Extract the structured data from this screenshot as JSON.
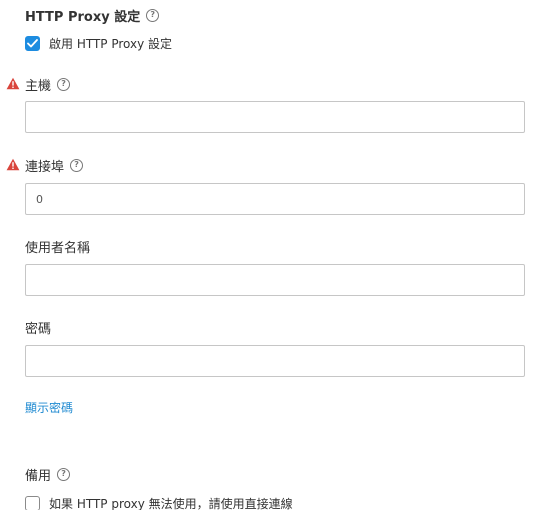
{
  "proxy_settings": {
    "title": "HTTP Proxy 設定",
    "enable_checkbox": {
      "label": "啟用 HTTP Proxy 設定",
      "checked": true
    }
  },
  "fields": {
    "host": {
      "label": "主機",
      "value": "",
      "required_warning": true
    },
    "port": {
      "label": "連接埠",
      "value": "0",
      "required_warning": true
    },
    "username": {
      "label": "使用者名稱",
      "value": ""
    },
    "password": {
      "label": "密碼",
      "value": ""
    }
  },
  "show_password_link": "顯示密碼",
  "fallback": {
    "title": "備用",
    "checkbox": {
      "label": "如果 HTTP proxy 無法使用，請使用直接連線",
      "checked": false
    }
  },
  "colors": {
    "accent": "#1d8ce0",
    "link": "#1f8ad1",
    "warning": "#d9453c",
    "border": "#c6c6c6"
  }
}
